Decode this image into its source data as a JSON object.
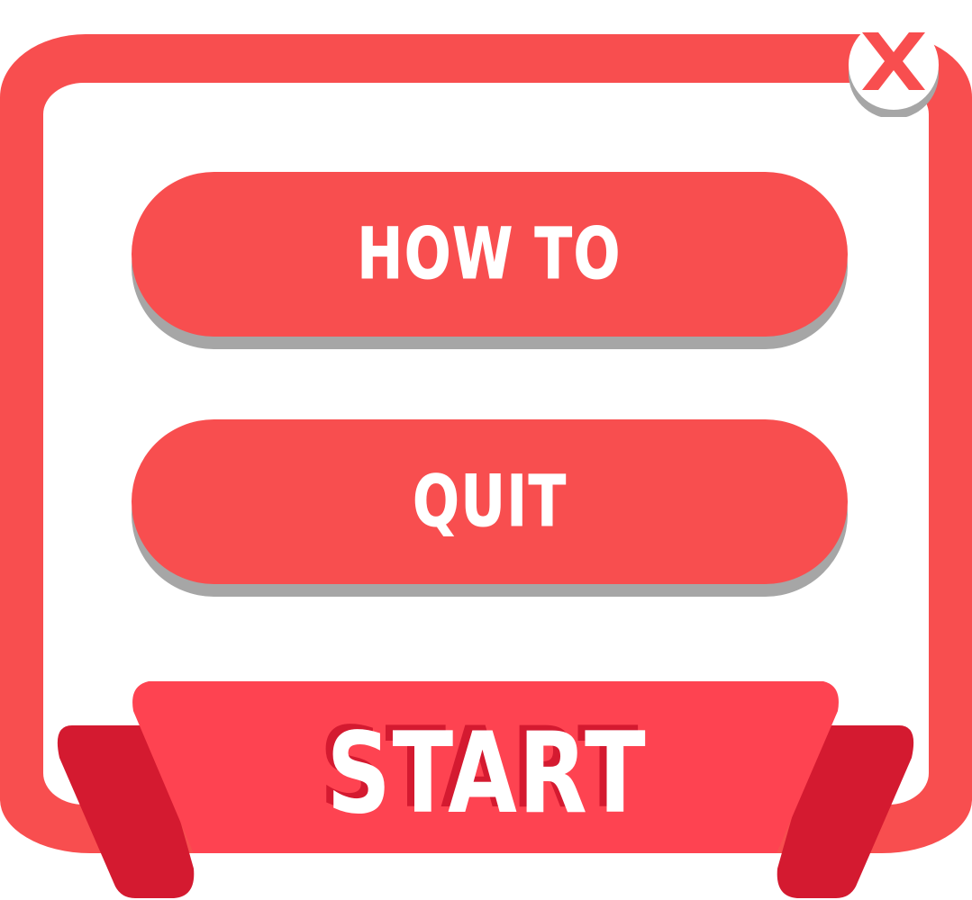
{
  "menu": {
    "how_to_label": "HOW TO",
    "quit_label": "QUIT",
    "start_label": "START"
  },
  "icons": {
    "close": "close-icon"
  },
  "colors": {
    "frame": "#f84e4f",
    "button": "#f84e4f",
    "button_shadow": "#a6a6a6",
    "ribbon": "#fe4351",
    "ribbon_fold": "#d41a30",
    "text": "#ffffff"
  }
}
